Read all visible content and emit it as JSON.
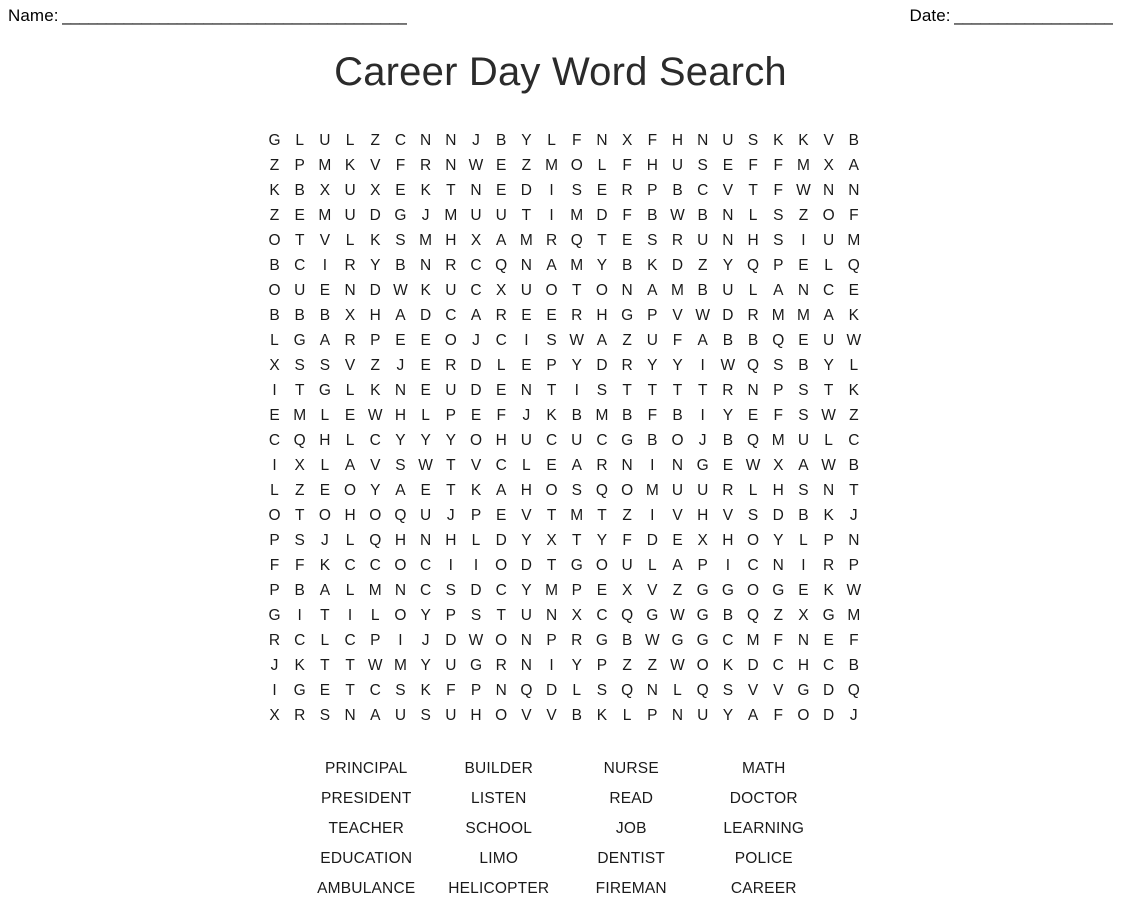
{
  "header": {
    "name_label": "Name:",
    "name_rule": "_______________________________________",
    "date_label": "Date:",
    "date_rule": "__________________"
  },
  "title": "Career Day Word Search",
  "grid": {
    "rows": 24,
    "cols": 24,
    "letters": [
      [
        "G",
        "L",
        "U",
        "L",
        "Z",
        "C",
        "N",
        "N",
        "J",
        "B",
        "Y",
        "L",
        "F",
        "N",
        "X",
        "F",
        "H",
        "N",
        "U",
        "S",
        "K",
        "K",
        "V",
        "B"
      ],
      [
        "Z",
        "P",
        "M",
        "K",
        "V",
        "F",
        "R",
        "N",
        "W",
        "E",
        "Z",
        "M",
        "O",
        "L",
        "F",
        "H",
        "U",
        "S",
        "E",
        "F",
        "F",
        "M",
        "X",
        "A"
      ],
      [
        "K",
        "B",
        "X",
        "U",
        "X",
        "E",
        "K",
        "T",
        "N",
        "E",
        "D",
        "I",
        "S",
        "E",
        "R",
        "P",
        "B",
        "C",
        "V",
        "T",
        "F",
        "W",
        "N",
        "N"
      ],
      [
        "Z",
        "E",
        "M",
        "U",
        "D",
        "G",
        "J",
        "M",
        "U",
        "U",
        "T",
        "I",
        "M",
        "D",
        "F",
        "B",
        "W",
        "B",
        "N",
        "L",
        "S",
        "Z",
        "O",
        "F"
      ],
      [
        "O",
        "T",
        "V",
        "L",
        "K",
        "S",
        "M",
        "H",
        "X",
        "A",
        "M",
        "R",
        "Q",
        "T",
        "E",
        "S",
        "R",
        "U",
        "N",
        "H",
        "S",
        "I",
        "U",
        "M"
      ],
      [
        "B",
        "C",
        "I",
        "R",
        "Y",
        "B",
        "N",
        "R",
        "C",
        "Q",
        "N",
        "A",
        "M",
        "Y",
        "B",
        "K",
        "D",
        "Z",
        "Y",
        "Q",
        "P",
        "E",
        "L",
        "Q"
      ],
      [
        "O",
        "U",
        "E",
        "N",
        "D",
        "W",
        "K",
        "U",
        "C",
        "X",
        "U",
        "O",
        "T",
        "O",
        "N",
        "A",
        "M",
        "B",
        "U",
        "L",
        "A",
        "N",
        "C",
        "E"
      ],
      [
        "B",
        "B",
        "B",
        "X",
        "H",
        "A",
        "D",
        "C",
        "A",
        "R",
        "E",
        "E",
        "R",
        "H",
        "G",
        "P",
        "V",
        "W",
        "D",
        "R",
        "M",
        "M",
        "A",
        "K"
      ],
      [
        "L",
        "G",
        "A",
        "R",
        "P",
        "E",
        "E",
        "O",
        "J",
        "C",
        "I",
        "S",
        "W",
        "A",
        "Z",
        "U",
        "F",
        "A",
        "B",
        "B",
        "Q",
        "E",
        "U",
        "W"
      ],
      [
        "X",
        "S",
        "S",
        "V",
        "Z",
        "J",
        "E",
        "R",
        "D",
        "L",
        "E",
        "P",
        "Y",
        "D",
        "R",
        "Y",
        "Y",
        "I",
        "W",
        "Q",
        "S",
        "B",
        "Y",
        "L"
      ],
      [
        "I",
        "T",
        "G",
        "L",
        "K",
        "N",
        "E",
        "U",
        "D",
        "E",
        "N",
        "T",
        "I",
        "S",
        "T",
        "T",
        "T",
        "T",
        "R",
        "N",
        "P",
        "S",
        "T",
        "K"
      ],
      [
        "E",
        "M",
        "L",
        "E",
        "W",
        "H",
        "L",
        "P",
        "E",
        "F",
        "J",
        "K",
        "B",
        "M",
        "B",
        "F",
        "B",
        "I",
        "Y",
        "E",
        "F",
        "S",
        "W",
        "Z"
      ],
      [
        "C",
        "Q",
        "H",
        "L",
        "C",
        "Y",
        "Y",
        "Y",
        "O",
        "H",
        "U",
        "C",
        "U",
        "C",
        "G",
        "B",
        "O",
        "J",
        "B",
        "Q",
        "M",
        "U",
        "L",
        "C"
      ],
      [
        "I",
        "X",
        "L",
        "A",
        "V",
        "S",
        "W",
        "T",
        "V",
        "C",
        "L",
        "E",
        "A",
        "R",
        "N",
        "I",
        "N",
        "G",
        "E",
        "W",
        "X",
        "A",
        "W",
        "B"
      ],
      [
        "L",
        "Z",
        "E",
        "O",
        "Y",
        "A",
        "E",
        "T",
        "K",
        "A",
        "H",
        "O",
        "S",
        "Q",
        "O",
        "M",
        "U",
        "U",
        "R",
        "L",
        "H",
        "S",
        "N",
        "T"
      ],
      [
        "O",
        "T",
        "O",
        "H",
        "O",
        "Q",
        "U",
        "J",
        "P",
        "E",
        "V",
        "T",
        "M",
        "T",
        "Z",
        "I",
        "V",
        "H",
        "V",
        "S",
        "D",
        "B",
        "K",
        "J"
      ],
      [
        "P",
        "S",
        "J",
        "L",
        "Q",
        "H",
        "N",
        "H",
        "L",
        "D",
        "Y",
        "X",
        "T",
        "Y",
        "F",
        "D",
        "E",
        "X",
        "H",
        "O",
        "Y",
        "L",
        "P",
        "N"
      ],
      [
        "F",
        "F",
        "K",
        "C",
        "C",
        "O",
        "C",
        "I",
        "I",
        "O",
        "D",
        "T",
        "G",
        "O",
        "U",
        "L",
        "A",
        "P",
        "I",
        "C",
        "N",
        "I",
        "R",
        "P"
      ],
      [
        "P",
        "B",
        "A",
        "L",
        "M",
        "N",
        "C",
        "S",
        "D",
        "C",
        "Y",
        "M",
        "P",
        "E",
        "X",
        "V",
        "Z",
        "G",
        "G",
        "O",
        "G",
        "E",
        "K",
        "W"
      ],
      [
        "G",
        "I",
        "T",
        "I",
        "L",
        "O",
        "Y",
        "P",
        "S",
        "T",
        "U",
        "N",
        "X",
        "C",
        "Q",
        "G",
        "W",
        "G",
        "B",
        "Q",
        "Z",
        "X",
        "G",
        "M"
      ],
      [
        "R",
        "C",
        "L",
        "C",
        "P",
        "I",
        "J",
        "D",
        "W",
        "O",
        "N",
        "P",
        "R",
        "G",
        "B",
        "W",
        "G",
        "G",
        "C",
        "M",
        "F",
        "N",
        "E",
        "F"
      ],
      [
        "J",
        "K",
        "T",
        "T",
        "W",
        "M",
        "Y",
        "U",
        "G",
        "R",
        "N",
        "I",
        "Y",
        "P",
        "Z",
        "Z",
        "W",
        "O",
        "K",
        "D",
        "C",
        "H",
        "C",
        "B"
      ],
      [
        "I",
        "G",
        "E",
        "T",
        "C",
        "S",
        "K",
        "F",
        "P",
        "N",
        "Q",
        "D",
        "L",
        "S",
        "Q",
        "N",
        "L",
        "Q",
        "S",
        "V",
        "V",
        "G",
        "D",
        "Q"
      ],
      [
        "X",
        "R",
        "S",
        "N",
        "A",
        "U",
        "S",
        "U",
        "H",
        "O",
        "V",
        "V",
        "B",
        "K",
        "L",
        "P",
        "N",
        "U",
        "Y",
        "A",
        "F",
        "O",
        "D",
        "J"
      ]
    ]
  },
  "wordlist": {
    "words": [
      "PRINCIPAL",
      "BUILDER",
      "NURSE",
      "MATH",
      "PRESIDENT",
      "LISTEN",
      "READ",
      "DOCTOR",
      "TEACHER",
      "SCHOOL",
      "JOB",
      "LEARNING",
      "EDUCATION",
      "LIMO",
      "DENTIST",
      "POLICE",
      "AMBULANCE",
      "HELICOPTER",
      "FIREMAN",
      "CAREER"
    ]
  }
}
